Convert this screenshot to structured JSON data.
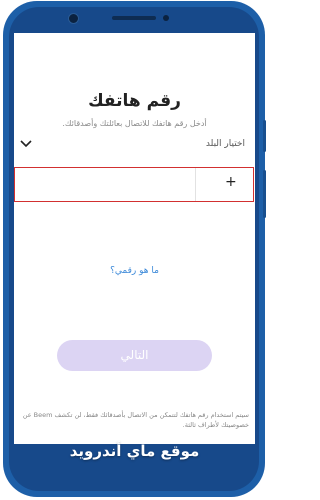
{
  "screen": {
    "title": "رقم هاتفك",
    "subtitle": "أدخل رقم هاتفك للاتصال بعائلتك وأصدقائك.",
    "country_label": "اختيار البلد",
    "country_icon": "chevron-down-icon",
    "phone_prefix": "+",
    "phone_value": "",
    "help_link": "ما هو رقمي؟",
    "next_button": "التالي",
    "disclaimer": "سيتم استخدام رقم هاتفك لتتمكن من الاتصال بأصدقائك فقط، لن تكشف Beem عن خصوصيتك لأطراف ثالثة."
  },
  "watermark": "موقع ماي أندرويد",
  "colors": {
    "phone_frame": "#1d5fa8",
    "accent_link": "#3d8ad9",
    "button_disabled": "#dcd4f3",
    "input_border": "#d23030"
  }
}
